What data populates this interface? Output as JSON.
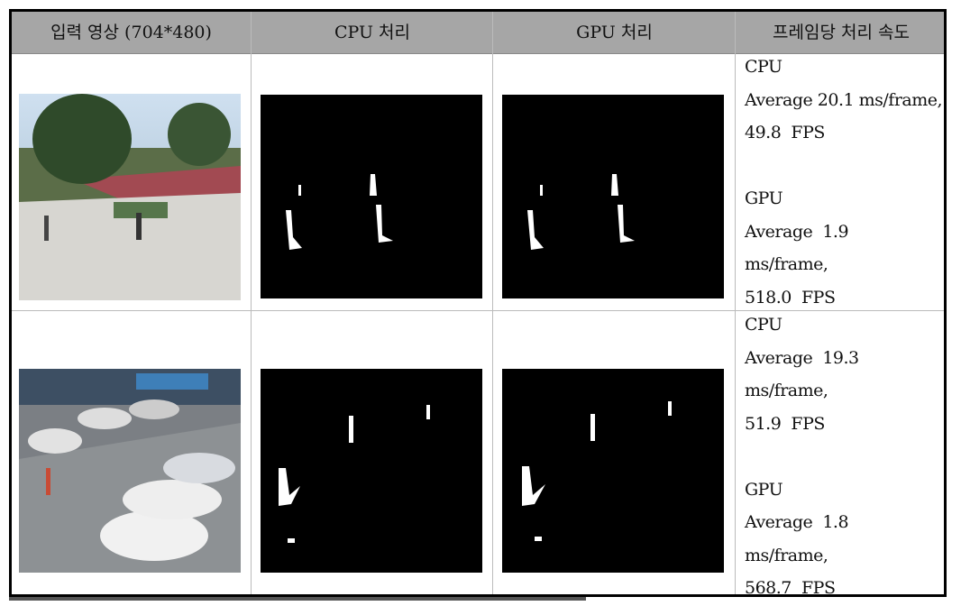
{
  "table": {
    "headers": [
      "입력 영상 (704*480)",
      "CPU 처리",
      "GPU 처리",
      "프레임당 처리 속도"
    ],
    "rows": [
      {
        "speed": {
          "cpu_label": "CPU",
          "cpu_line1": "Average 20.1 ms/frame,",
          "cpu_line2": "49.8  FPS",
          "gpu_label": "GPU",
          "gpu_line1": "Average  1.9",
          "gpu_line2": "ms/frame,",
          "gpu_line3": "518.0  FPS"
        }
      },
      {
        "speed": {
          "cpu_label": "CPU",
          "cpu_line1": "Average  19.3",
          "cpu_line2": "ms/frame,",
          "cpu_line3": "51.9  FPS",
          "gpu_label": "GPU",
          "gpu_line1": "Average  1.8",
          "gpu_line2": "ms/frame,",
          "gpu_line3": "568.7  FPS"
        }
      }
    ]
  }
}
